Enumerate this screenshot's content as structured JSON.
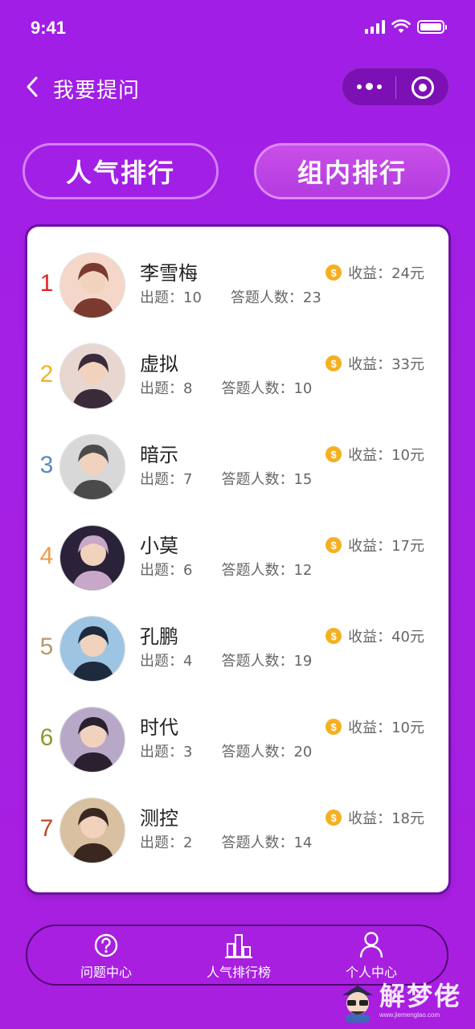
{
  "status_bar": {
    "time": "9:41"
  },
  "nav": {
    "title": "我要提问"
  },
  "tabs": [
    {
      "label": "人气排行",
      "active": false
    },
    {
      "label": "组内排行",
      "active": true
    }
  ],
  "list": {
    "questions_label": "出题：",
    "answerers_label": "答题人数：",
    "income_label": "收益：",
    "coin_symbol": "$",
    "items": [
      {
        "rank": "1",
        "name": "李雪梅",
        "questions": "10",
        "answerers": "23",
        "income": "24元",
        "rank_color": "#e0262b"
      },
      {
        "rank": "2",
        "name": "虚拟",
        "questions": "8",
        "answerers": "10",
        "income": "33元",
        "rank_color": "#f0b22c"
      },
      {
        "rank": "3",
        "name": "暗示",
        "questions": "7",
        "answerers": "15",
        "income": "10元",
        "rank_color": "#5a89b8"
      },
      {
        "rank": "4",
        "name": "小莫",
        "questions": "6",
        "answerers": "12",
        "income": "17元",
        "rank_color": "#ef9a4a"
      },
      {
        "rank": "5",
        "name": "孔鹏",
        "questions": "4",
        "answerers": "19",
        "income": "40元",
        "rank_color": "#b49a6e"
      },
      {
        "rank": "6",
        "name": "时代",
        "questions": "3",
        "answerers": "20",
        "income": "10元",
        "rank_color": "#8a9a2e"
      },
      {
        "rank": "7",
        "name": "测控",
        "questions": "2",
        "answerers": "14",
        "income": "18元",
        "rank_color": "#c24a2a"
      }
    ]
  },
  "bottom_nav": [
    {
      "label": "问题中心",
      "icon": "question-circle-icon"
    },
    {
      "label": "人气排行榜",
      "icon": "bar-chart-icon"
    },
    {
      "label": "个人中心",
      "icon": "user-icon"
    }
  ],
  "watermark": {
    "text": "解梦佬",
    "url": "www.jiemenglao.com"
  }
}
